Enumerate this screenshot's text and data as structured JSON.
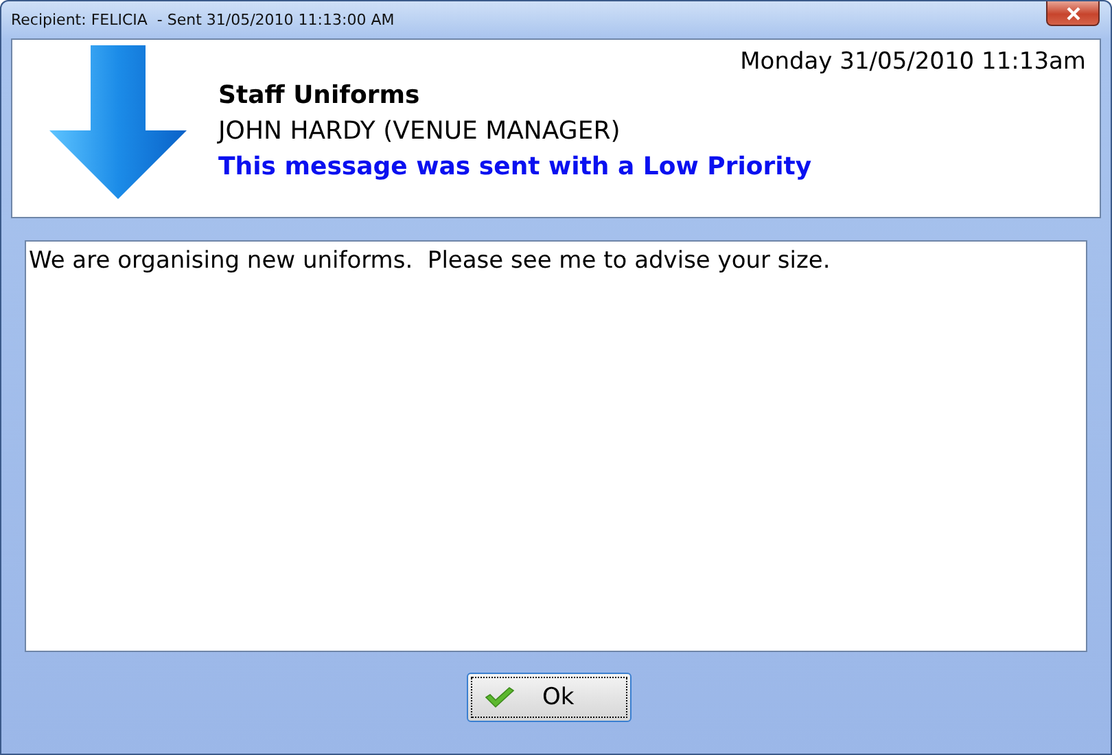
{
  "window": {
    "title": "Recipient: FELICIA  - Sent 31/05/2010 11:13:00 AM"
  },
  "header": {
    "timestamp": "Monday 31/05/2010 11:13am",
    "subject": "Staff Uniforms",
    "sender": "JOHN HARDY (VENUE MANAGER)",
    "priority_note": "This message was sent with a Low Priority"
  },
  "message": {
    "body": "We are organising new uniforms.  Please see me to advise your size."
  },
  "buttons": [
    {
      "label": "Ok"
    }
  ]
}
